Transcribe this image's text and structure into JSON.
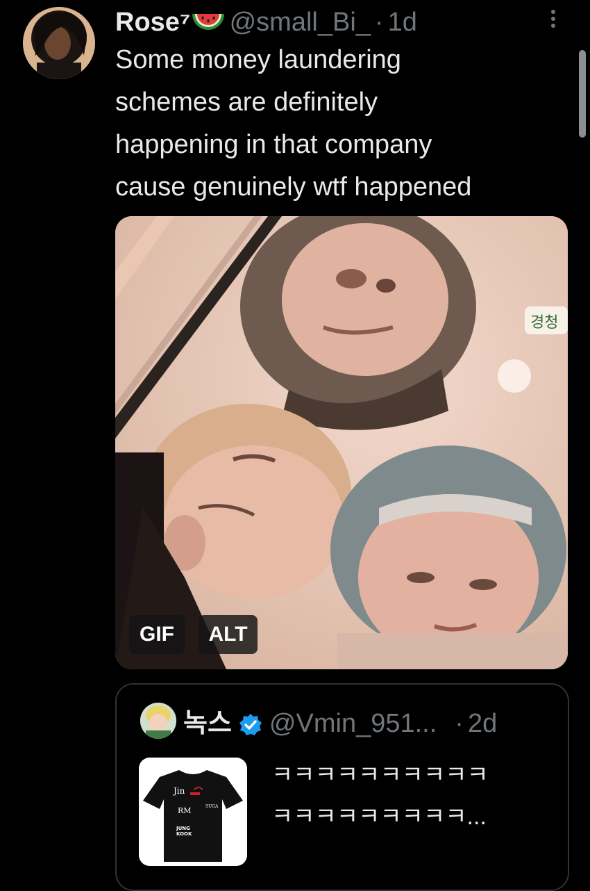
{
  "tweet": {
    "author_name": "Rose⁷",
    "author_emoji": "watermelon-emoji",
    "handle": "@small_Bi_",
    "separator": "·",
    "time": "1d",
    "text_lines": [
      "Some money laundering",
      "schemes are definitely",
      "happening in that company",
      "cause genuinely wtf happened"
    ],
    "media": {
      "gif_label": "GIF",
      "alt_label": "ALT",
      "caption_fragment": "경청"
    }
  },
  "quote": {
    "author_name": "녹스",
    "verified": true,
    "handle": "@Vmin_951...",
    "separator": "·",
    "time": "2d",
    "text_lines": [
      "ㅋㅋㅋㅋㅋㅋㅋㅋㅋㅋ",
      "ㅋㅋㅋㅋㅋㅋㅋㅋㅋ..."
    ],
    "thumbnail_shirt_text": [
      "Jin",
      "RM",
      "JUNG",
      "KOOK",
      "SUGA"
    ]
  },
  "colors": {
    "background": "#000000",
    "text_primary": "#e7e9ea",
    "text_secondary": "#71767b",
    "border": "#2f3336",
    "verified_blue": "#1d9bf0"
  }
}
